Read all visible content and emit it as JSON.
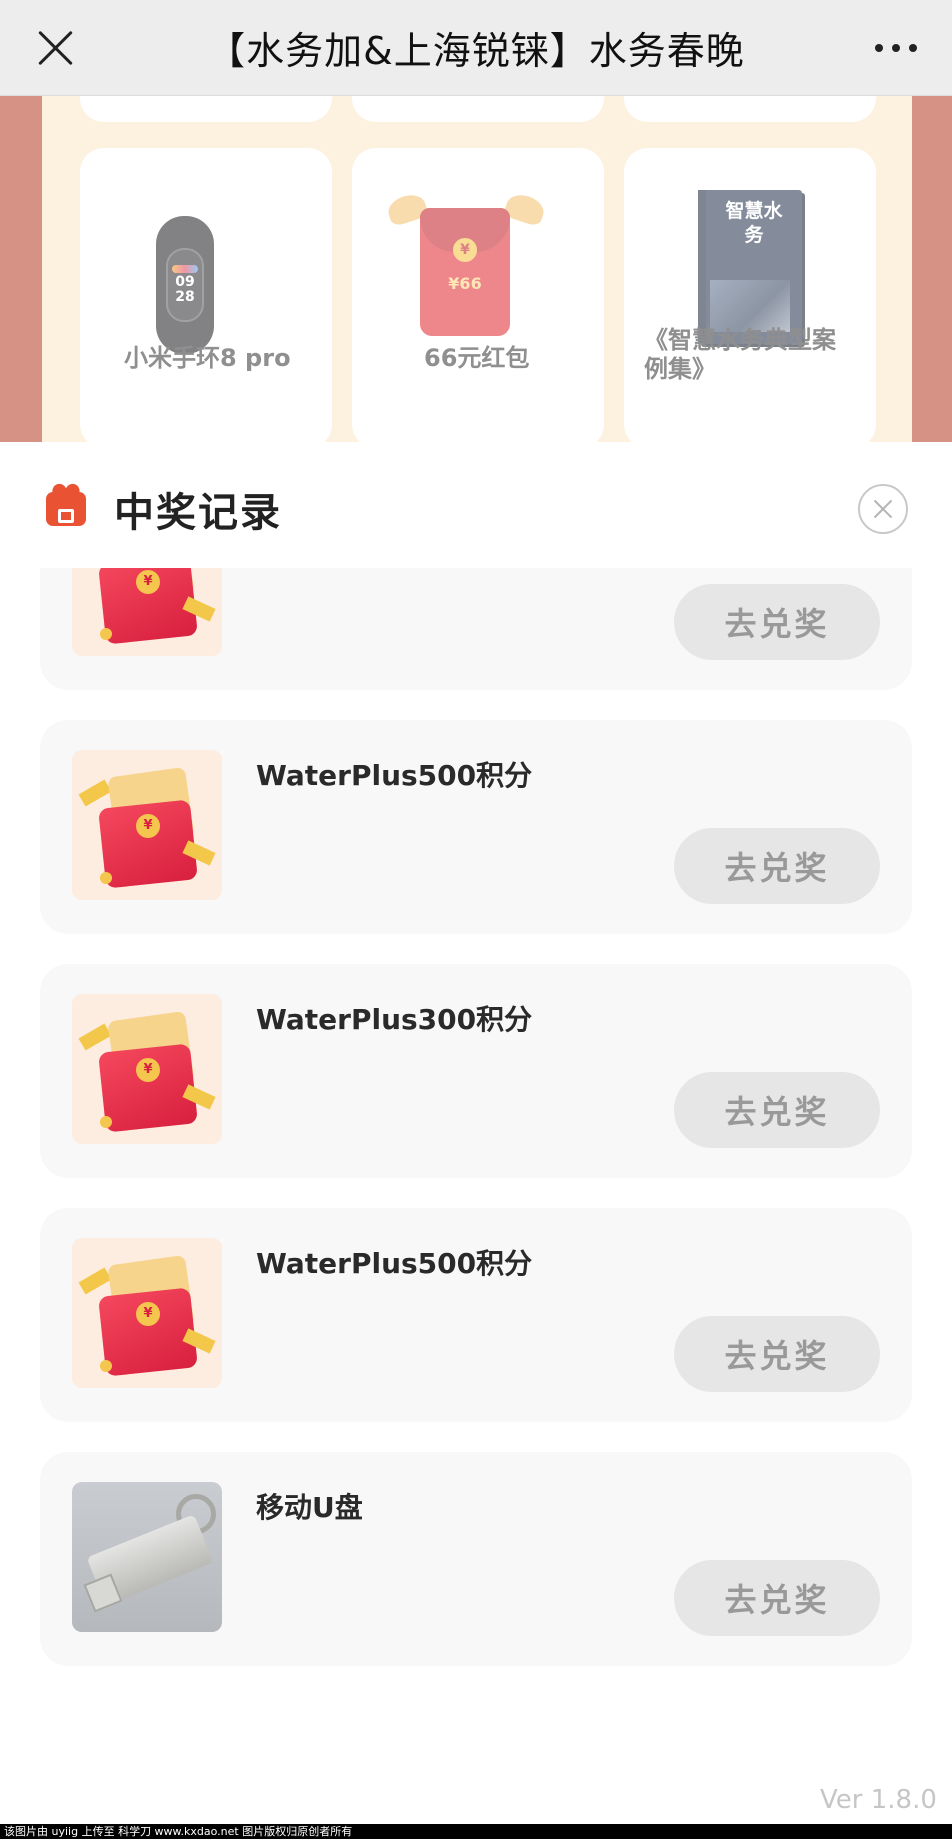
{
  "navbar": {
    "title": "【水务加&上海锐铼】水务春晚",
    "close_icon": "close-icon",
    "more_icon": "more-dots-icon"
  },
  "background_prizes": [
    {
      "name": "小米手环8 pro",
      "image": "smart-band"
    },
    {
      "name": "66元红包",
      "image": "red-packet",
      "amount_text": "¥66",
      "coin": "¥"
    },
    {
      "name": "《智慧水务典型案例集》",
      "image": "book",
      "book_title": "智慧水务"
    }
  ],
  "sheet": {
    "title": "中奖记录",
    "icon": "gift-icon",
    "close_icon": "close-circle-icon"
  },
  "records": [
    {
      "name": "",
      "image": "red-packet",
      "coin": "¥",
      "button": "去兑奖"
    },
    {
      "name": "WaterPlus500积分",
      "image": "red-packet",
      "coin": "¥",
      "button": "去兑奖"
    },
    {
      "name": "WaterPlus300积分",
      "image": "red-packet",
      "coin": "¥",
      "button": "去兑奖"
    },
    {
      "name": "WaterPlus500积分",
      "image": "red-packet",
      "coin": "¥",
      "button": "去兑奖"
    },
    {
      "name": "移动U盘",
      "image": "usb-drive",
      "button": "去兑奖"
    }
  ],
  "version": "Ver 1.8.0",
  "watermark": "该图片由 uyiig 上传至 科学刀 www.kxdao.net 图片版权归原创者所有",
  "colors": {
    "accent": "#e95232",
    "button_bg": "#e6e6e6",
    "button_text": "#999999",
    "card_bg": "#f8f8f8"
  }
}
